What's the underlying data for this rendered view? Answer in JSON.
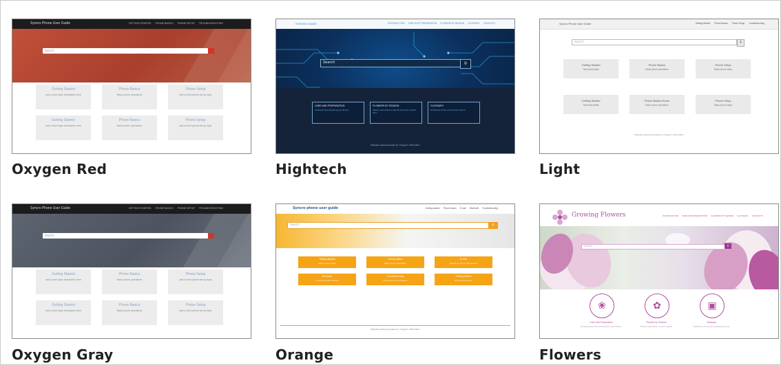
{
  "themes": [
    {
      "caption": "Oxygen Red",
      "site_title": "Syncro Phone User Guide",
      "menu": [
        "GETTING STARTED",
        "PHONE BASICS",
        "PHONE SETUP",
        "TROUBLESHOOTING"
      ],
      "search_placeholder": "Search",
      "tiles": [
        {
          "title": "Getting Started",
          "desc": "add a short topic description here"
        },
        {
          "title": "Phone Basics",
          "desc": "Basic phone operations"
        },
        {
          "title": "Phone Setup",
          "desc": "add a short phone set up topic"
        },
        {
          "title": "Getting Started",
          "desc": "add a short topic description here"
        },
        {
          "title": "Phone Basics",
          "desc": "Basic phone operations"
        },
        {
          "title": "Phone Setup",
          "desc": "add a short phone set up topic"
        }
      ],
      "accent": "#b54a35"
    },
    {
      "caption": "Hightech",
      "site_title": "SYNCRO GUIDE",
      "menu": [
        "INTRODUCTION",
        "CASE SHOT PREPARATION",
        "FLOWERS BY SEASON",
        "GLOSSARY",
        "CONTACTS"
      ],
      "search_placeholder": "Search",
      "tiles": [
        {
          "title": "CARE AND PREPARATION",
          "desc": "Caring for and preparing your flowers"
        },
        {
          "title": "FLOWERS BY SEASON",
          "desc": "Flowers and seasons and the best time to plant them"
        },
        {
          "title": "GLOSSARY",
          "desc": "Definitions of the most common terms"
        }
      ],
      "footer": "WebHelp output generated by <oXygen/> XML Author",
      "accent": "#0f4d8a"
    },
    {
      "caption": "Light",
      "site_title": "Syncro Phone User Guide",
      "menu": [
        "Getting Started",
        "Phone Basics",
        "Phone Setup",
        "Troubleshooting"
      ],
      "search_placeholder": "Search",
      "tiles": [
        {
          "title": "Getting Started",
          "desc": "Technical details"
        },
        {
          "title": "Phone Basics",
          "desc": "Basic phone operations"
        },
        {
          "title": "Phone Setup",
          "desc": "Basic phone setup"
        },
        {
          "title": "Getting Started",
          "desc": "Technical details"
        },
        {
          "title": "Phone Basics Home",
          "desc": "Basic phone operations"
        },
        {
          "title": "Phone Setup",
          "desc": "Basic phone setup"
        }
      ],
      "footer": "WebHelp output generated by <oXygen/> XML Author",
      "accent": "#eaeaea"
    },
    {
      "caption": "Oxygen Gray",
      "site_title": "Syncro Phone User Guide",
      "menu": [
        "GETTING STARTED",
        "PHONE BASICS",
        "PHONE SETUP",
        "TROUBLESHOOTING"
      ],
      "search_placeholder": "Search",
      "tiles": [
        {
          "title": "Getting Started",
          "desc": "add a short topic description here"
        },
        {
          "title": "Phone Basics",
          "desc": "Basic phone operations"
        },
        {
          "title": "Phone Setup",
          "desc": "add a short phone set up topic"
        },
        {
          "title": "Getting Started",
          "desc": "add a short topic description here"
        },
        {
          "title": "Phone Basics",
          "desc": "Basic phone operations"
        },
        {
          "title": "Phone Setup",
          "desc": "add a short phone set up topic"
        }
      ],
      "accent": "#555c68"
    },
    {
      "caption": "Orange",
      "site_title": "Syncro phone user guide",
      "menu": [
        "Getting started",
        "Phone basics",
        "E-mail",
        "Bluetooth",
        "Troubleshooting"
      ],
      "search_placeholder": "Search",
      "tiles": [
        {
          "title": "Getting started",
          "desc": "Setup a new phone"
        },
        {
          "title": "Phone basics",
          "desc": "Basic phone operations"
        },
        {
          "title": "E-mail",
          "desc": "Setting up your e-mail account"
        },
        {
          "title": "Bluetooth",
          "desc": "Connecting other devices"
        },
        {
          "title": "Troubleshooting",
          "desc": "Solving common problems"
        },
        {
          "title": "Getting started",
          "desc": "Setup a new phone"
        }
      ],
      "footer": "WebHelp output generated by <oXygen/> XML Author",
      "accent": "#f5a416"
    },
    {
      "caption": "Flowers",
      "site_title": "Growing Flowers",
      "menu": [
        "INTRODUCTION",
        "CARE AND PREPARATION",
        "FLOWERS BY SEASON",
        "GLOSSARY",
        "CONTACTS"
      ],
      "search_placeholder": "Search",
      "tiles": [
        {
          "title": "Care and Preparation",
          "desc": "Preparing the soil and caring for your flowers"
        },
        {
          "title": "Flowers by Season",
          "desc": "Flowers that bloom in each season"
        },
        {
          "title": "Glossary",
          "desc": "Definitions of common gardening terms"
        }
      ],
      "accent": "#b14ea0"
    }
  ]
}
